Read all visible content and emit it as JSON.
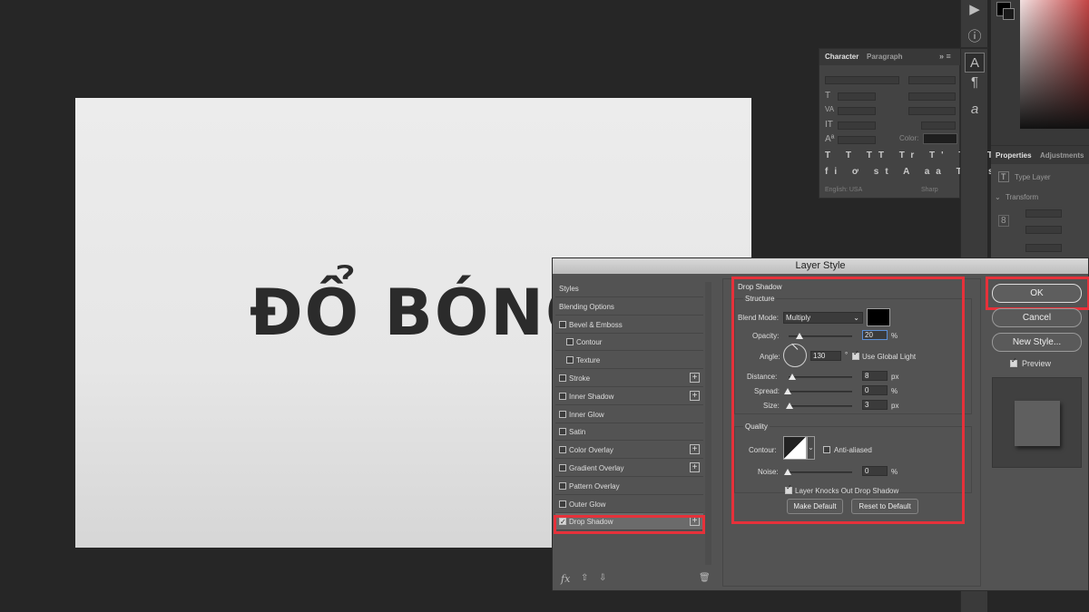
{
  "canvas": {
    "text": "ĐỔ BÓNG"
  },
  "tool_strip": {
    "icons": [
      "play-icon",
      "info-icon",
      "character-icon",
      "paragraph-icon",
      "glyphs-icon"
    ]
  },
  "character_panel": {
    "tabs": [
      "Character",
      "Paragraph"
    ],
    "color_label": "Color:",
    "language": "English: USA",
    "antialias": "Sharp"
  },
  "properties_panel": {
    "tabs": [
      "Properties",
      "Adjustments"
    ],
    "layer_type": "Type Layer",
    "section": "Transform"
  },
  "dialog": {
    "title": "Layer Style",
    "styles_list": [
      {
        "label": "Styles",
        "checkbox": false,
        "plus": false,
        "indent": false
      },
      {
        "label": "Blending Options",
        "checkbox": false,
        "plus": false,
        "indent": false
      },
      {
        "label": "Bevel & Emboss",
        "checkbox": true,
        "checked": false,
        "plus": false,
        "indent": false
      },
      {
        "label": "Contour",
        "checkbox": true,
        "checked": false,
        "plus": false,
        "indent": true
      },
      {
        "label": "Texture",
        "checkbox": true,
        "checked": false,
        "plus": false,
        "indent": true
      },
      {
        "label": "Stroke",
        "checkbox": true,
        "checked": false,
        "plus": true,
        "indent": false
      },
      {
        "label": "Inner Shadow",
        "checkbox": true,
        "checked": false,
        "plus": true,
        "indent": false
      },
      {
        "label": "Inner Glow",
        "checkbox": true,
        "checked": false,
        "plus": false,
        "indent": false
      },
      {
        "label": "Satin",
        "checkbox": true,
        "checked": false,
        "plus": false,
        "indent": false
      },
      {
        "label": "Color Overlay",
        "checkbox": true,
        "checked": false,
        "plus": true,
        "indent": false
      },
      {
        "label": "Gradient Overlay",
        "checkbox": true,
        "checked": false,
        "plus": true,
        "indent": false
      },
      {
        "label": "Pattern Overlay",
        "checkbox": true,
        "checked": false,
        "plus": false,
        "indent": false
      },
      {
        "label": "Outer Glow",
        "checkbox": true,
        "checked": false,
        "plus": false,
        "indent": false
      },
      {
        "label": "Drop Shadow",
        "checkbox": true,
        "checked": true,
        "plus": true,
        "indent": false,
        "selected": true
      }
    ],
    "fx_label": "fx",
    "drop_shadow": {
      "title": "Drop Shadow",
      "structure_title": "Structure",
      "blend_mode_label": "Blend Mode:",
      "blend_mode": "Multiply",
      "shadow_color": "#000000",
      "opacity_label": "Opacity:",
      "opacity": "20",
      "opacity_unit": "%",
      "angle_label": "Angle:",
      "angle": "130",
      "angle_unit": "°",
      "use_global_light": "Use Global Light",
      "distance_label": "Distance:",
      "distance": "8",
      "distance_unit": "px",
      "spread_label": "Spread:",
      "spread": "0",
      "spread_unit": "%",
      "size_label": "Size:",
      "size": "3",
      "size_unit": "px",
      "quality_title": "Quality",
      "contour_label": "Contour:",
      "anti_aliased": "Anti-aliased",
      "noise_label": "Noise:",
      "noise": "0",
      "noise_unit": "%",
      "knockout": "Layer Knocks Out Drop Shadow",
      "make_default": "Make Default",
      "reset_default": "Reset to Default"
    },
    "buttons": {
      "ok": "OK",
      "cancel": "Cancel",
      "new_style": "New Style...",
      "preview": "Preview"
    }
  },
  "colors": {
    "highlight": "#e6313a",
    "dialog_bg": "#535353"
  }
}
